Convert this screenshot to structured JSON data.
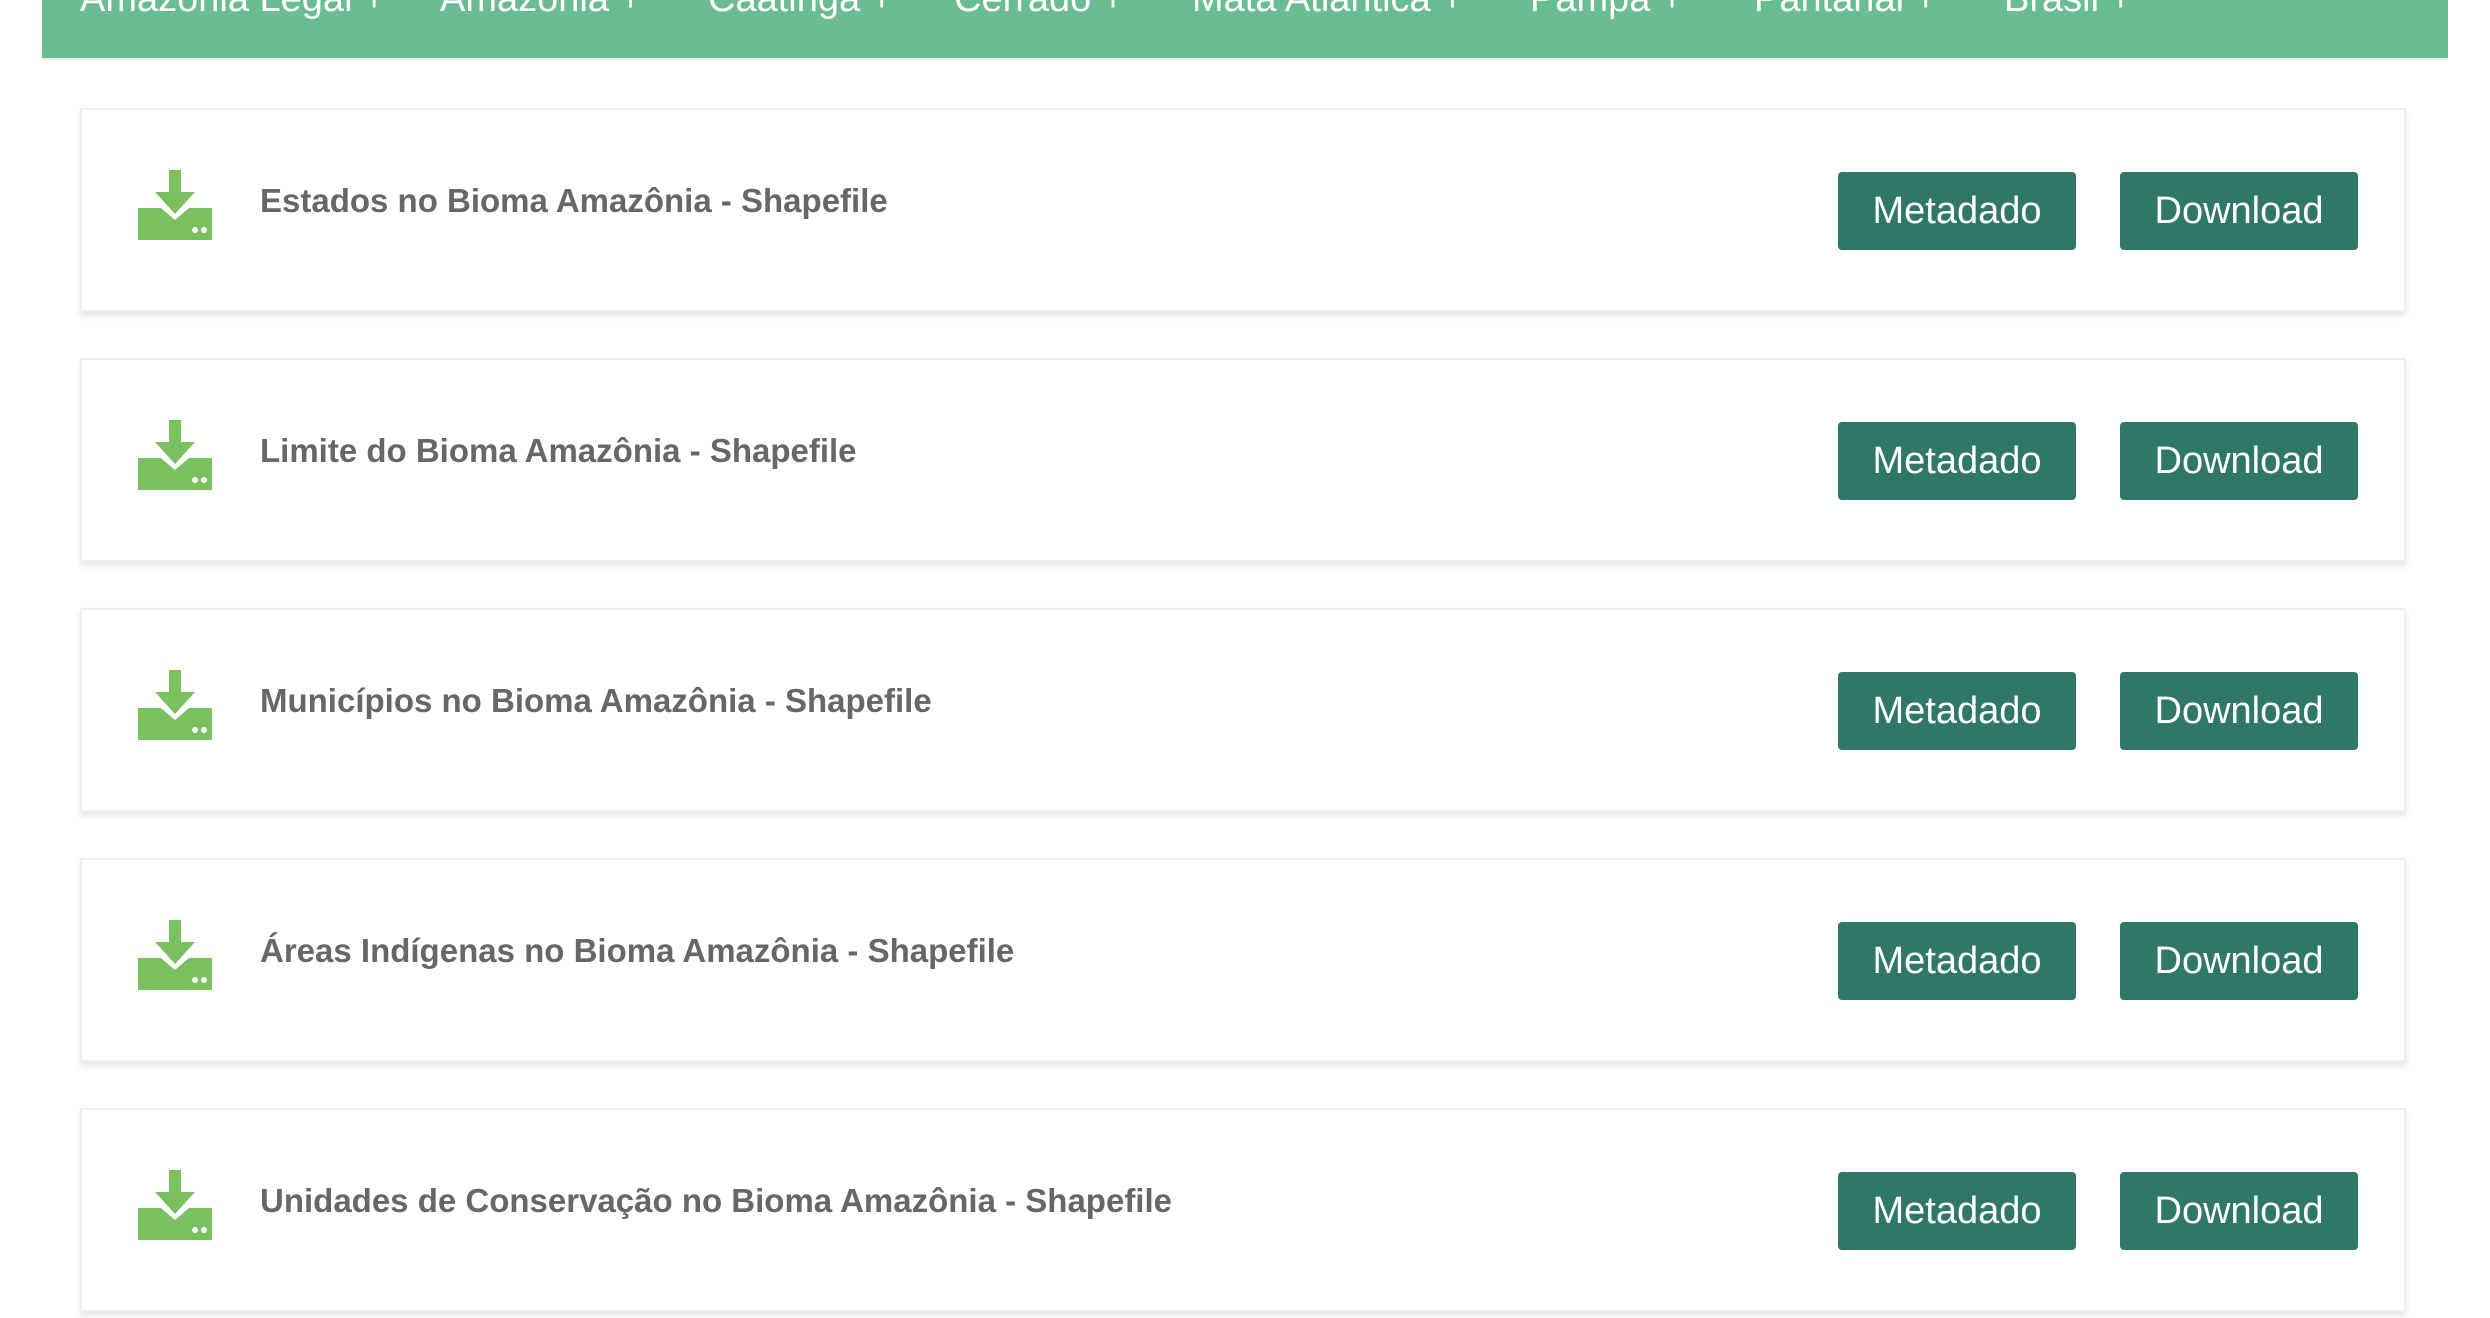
{
  "colors": {
    "nav_background": "#6abd93",
    "button_background": "#2f7766",
    "icon_green": "#79c15f",
    "title_text": "#676767"
  },
  "nav": {
    "items": [
      {
        "label": "Amazônia Legal +"
      },
      {
        "label": "Amazônia +"
      },
      {
        "label": "Caatinga +"
      },
      {
        "label": "Cerrado +"
      },
      {
        "label": "Mata Atlântica +"
      },
      {
        "label": "Pampa +"
      },
      {
        "label": "Pantanal +"
      },
      {
        "label": "Brasil +"
      }
    ]
  },
  "datasets": [
    {
      "title": "Estados no Bioma Amazônia - Shapefile",
      "icon": "download-tray-icon",
      "metadata_label": "Metadado",
      "download_label": "Download"
    },
    {
      "title": "Limite do Bioma Amazônia - Shapefile",
      "icon": "download-tray-icon",
      "metadata_label": "Metadado",
      "download_label": "Download"
    },
    {
      "title": "Municípios no Bioma Amazônia - Shapefile",
      "icon": "download-tray-icon",
      "metadata_label": "Metadado",
      "download_label": "Download"
    },
    {
      "title": "Áreas Indígenas no Bioma Amazônia - Shapefile",
      "icon": "download-tray-icon",
      "metadata_label": "Metadado",
      "download_label": "Download"
    },
    {
      "title": "Unidades de Conservação no Bioma Amazônia - Shapefile",
      "icon": "download-tray-icon",
      "metadata_label": "Metadado",
      "download_label": "Download"
    }
  ]
}
